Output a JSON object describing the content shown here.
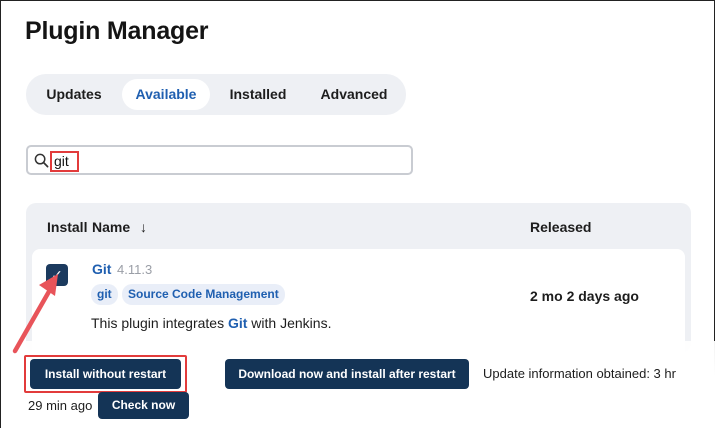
{
  "page": {
    "title": "Plugin Manager"
  },
  "tabs": [
    {
      "label": "Updates",
      "active": false
    },
    {
      "label": "Available",
      "active": true
    },
    {
      "label": "Installed",
      "active": false
    },
    {
      "label": "Advanced",
      "active": false
    }
  ],
  "search": {
    "value": "git",
    "icon": "search-icon"
  },
  "table": {
    "headers": {
      "install": "Install",
      "name": "Name",
      "name_sort": "↓",
      "released": "Released"
    },
    "rows": [
      {
        "checked": true,
        "checkmark": "✓",
        "name": "Git",
        "version": "4.11.3",
        "tags": [
          "git",
          "Source Code Management"
        ],
        "description_before": "This plugin integrates ",
        "description_link": "Git",
        "description_after": " with Jenkins.",
        "released": "2 mo 2 days ago"
      }
    ]
  },
  "actions": {
    "install_without_restart": "Install without restart",
    "download_install_after_restart": "Download now and install after restart",
    "check_now": "Check now",
    "update_info_line1": "Update information obtained: 3 hr",
    "update_info_line2": "29 min ago"
  },
  "colors": {
    "accent": "#1f5fb0",
    "button": "#143456",
    "annotation": "#e23b3b"
  }
}
